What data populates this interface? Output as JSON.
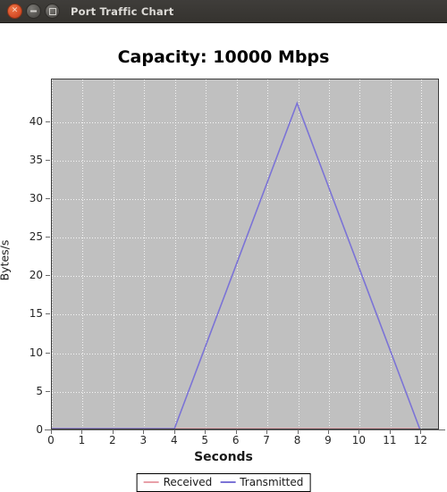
{
  "window": {
    "title": "Port Traffic Chart",
    "controls": [
      {
        "name": "close-button",
        "glyph": "×"
      },
      {
        "name": "minimize-button",
        "glyph": "−"
      },
      {
        "name": "maximize-button",
        "glyph": "□"
      }
    ]
  },
  "chart_data": {
    "type": "line",
    "title": "Capacity: 10000 Mbps",
    "xlabel": "Seconds",
    "ylabel": "Bytes/s",
    "xlim": [
      0,
      12.6
    ],
    "ylim": [
      0,
      45.5
    ],
    "xticks": [
      0,
      1,
      2,
      3,
      4,
      5,
      6,
      7,
      8,
      9,
      10,
      11,
      12
    ],
    "yticks": [
      0,
      5,
      10,
      15,
      20,
      25,
      30,
      35,
      40
    ],
    "grid": true,
    "legend_position": "bottom",
    "series": [
      {
        "name": "Received",
        "color": "#e8a0a8",
        "x": [
          0,
          1,
          2,
          3,
          4,
          5,
          6,
          7,
          8,
          9,
          10,
          11,
          12
        ],
        "values": [
          0,
          0,
          0,
          0,
          0,
          0,
          0,
          0,
          0,
          0,
          0,
          0,
          0
        ]
      },
      {
        "name": "Transmitted",
        "color": "#7b73d6",
        "x": [
          0,
          1,
          2,
          3,
          4,
          5,
          6,
          7,
          8,
          9,
          10,
          11,
          12
        ],
        "values": [
          0,
          0,
          0,
          0,
          0,
          10.6,
          21.2,
          31.8,
          42.4,
          31.8,
          21.2,
          10.6,
          0
        ]
      }
    ]
  },
  "legend": {
    "entries": [
      {
        "label": "Received",
        "color": "#e8a0a8"
      },
      {
        "label": "Transmitted",
        "color": "#7b73d6"
      }
    ]
  },
  "colors": {
    "plot_background": "#c0c0c0",
    "page_background": "#ffffff",
    "gridline": "#ffffff",
    "titlebar": "#3b3936",
    "titlebar_text": "#dedcd8",
    "received": "#e8a0a8",
    "transmitted": "#7b73d6"
  }
}
